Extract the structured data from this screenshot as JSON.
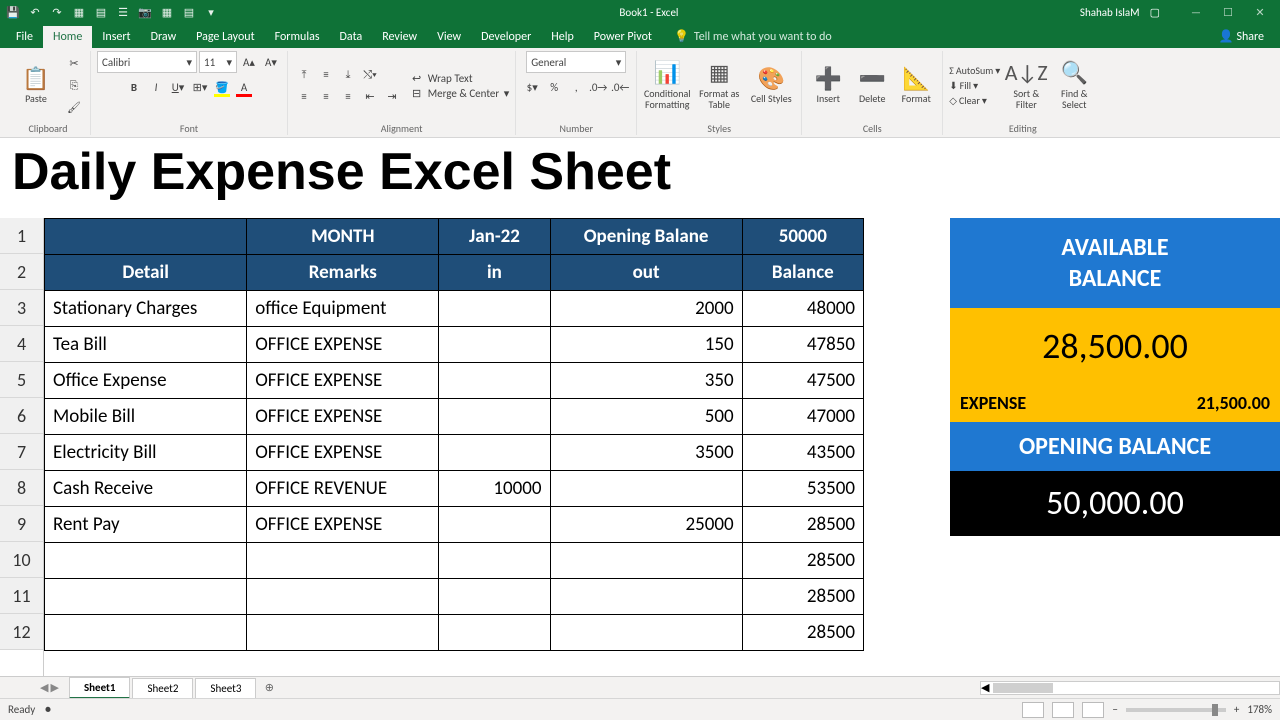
{
  "window": {
    "title": "Book1 - Excel",
    "user": "Shahab IslaM",
    "share": "Share"
  },
  "menu": {
    "file": "File",
    "tabs": [
      "Home",
      "Insert",
      "Draw",
      "Page Layout",
      "Formulas",
      "Data",
      "Review",
      "View",
      "Developer",
      "Help",
      "Power Pivot"
    ],
    "active": "Home",
    "tellme": "Tell me what you want to do"
  },
  "ribbon": {
    "clipboard": {
      "label": "Clipboard",
      "paste": "Paste"
    },
    "font": {
      "label": "Font",
      "name": "Calibri",
      "size": "11"
    },
    "alignment": {
      "label": "Alignment",
      "wrap": "Wrap Text",
      "merge": "Merge & Center"
    },
    "number": {
      "label": "Number",
      "format": "General"
    },
    "styles": {
      "label": "Styles",
      "cond": "Conditional Formatting",
      "table": "Format as Table",
      "cell": "Cell Styles"
    },
    "cells": {
      "label": "Cells",
      "insert": "Insert",
      "delete": "Delete",
      "format": "Format"
    },
    "editing": {
      "label": "Editing",
      "autosum": "AutoSum",
      "fill": "Fill",
      "clear": "Clear",
      "sort": "Sort & Filter",
      "find": "Find & Select"
    }
  },
  "overlay_title": "Daily Expense Excel Sheet",
  "header1": {
    "a": "",
    "b": "MONTH",
    "c": "Jan-22",
    "d": "Opening Balane",
    "e": "50000"
  },
  "header2": {
    "a": "Detail",
    "b": "Remarks",
    "c": "in",
    "d": "out",
    "e": "Balance"
  },
  "rows": [
    {
      "n": "3",
      "detail": "Stationary Charges",
      "remarks": "office Equipment",
      "in": "",
      "out": "2000",
      "bal": "48000"
    },
    {
      "n": "4",
      "detail": "Tea Bill",
      "remarks": "OFFICE EXPENSE",
      "in": "",
      "out": "150",
      "bal": "47850"
    },
    {
      "n": "5",
      "detail": "Office Expense",
      "remarks": "OFFICE EXPENSE",
      "in": "",
      "out": "350",
      "bal": "47500"
    },
    {
      "n": "6",
      "detail": "Mobile Bill",
      "remarks": "OFFICE EXPENSE",
      "in": "",
      "out": "500",
      "bal": "47000"
    },
    {
      "n": "7",
      "detail": "Electricity Bill",
      "remarks": "OFFICE EXPENSE",
      "in": "",
      "out": "3500",
      "bal": "43500"
    },
    {
      "n": "8",
      "detail": "Cash Receive",
      "remarks": "OFFICE REVENUE",
      "in": "10000",
      "out": "",
      "bal": "53500"
    },
    {
      "n": "9",
      "detail": "Rent Pay",
      "remarks": "OFFICE EXPENSE",
      "in": "",
      "out": "25000",
      "bal": "28500"
    },
    {
      "n": "10",
      "detail": "",
      "remarks": "",
      "in": "",
      "out": "",
      "bal": "28500"
    },
    {
      "n": "11",
      "detail": "",
      "remarks": "",
      "in": "",
      "out": "",
      "bal": "28500"
    },
    {
      "n": "12",
      "detail": "",
      "remarks": "",
      "in": "",
      "out": "",
      "bal": "28500"
    }
  ],
  "summary": {
    "avail_label": "AVAILABLE BALANCE",
    "avail_value": "28,500.00",
    "expense_label": "EXPENSE",
    "expense_value": "21,500.00",
    "opening_label": "OPENING BALANCE",
    "opening_value": "50,000.00"
  },
  "tabs": {
    "sheets": [
      "Sheet1",
      "Sheet2",
      "Sheet3"
    ],
    "active": "Sheet1"
  },
  "status": {
    "ready": "Ready",
    "zoom": "178%"
  }
}
